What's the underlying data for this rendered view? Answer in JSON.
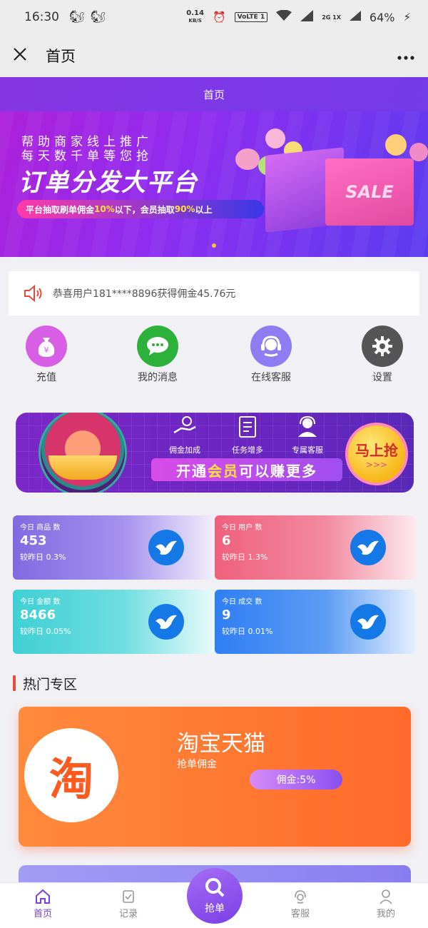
{
  "status_bar": {
    "time": "16:30",
    "speed": "0.14",
    "speed_unit": "KB/S",
    "volte": "VoLTE 1",
    "network": "2G 1X",
    "battery": "64%"
  },
  "titlebar": {
    "title": "首页"
  },
  "banner": {
    "header": "首页",
    "line1": "帮助商家线上推广",
    "line2": "每天数千单等您抢",
    "headline": "订单分发大平台",
    "pill_a": "平台抽取刷单佣金",
    "pill_b": "10%",
    "pill_c": "以下，会员抽取",
    "pill_d": "90%",
    "pill_e": "以上",
    "bag_text": "SALE"
  },
  "notice": {
    "text": "恭喜用户181****8896获得佣金45.76元"
  },
  "menu": {
    "items": [
      {
        "label": "充值",
        "icon": "money-bag-icon",
        "color": "#d95ee6"
      },
      {
        "label": "我的消息",
        "icon": "chat-icon",
        "color": "#2cb23a"
      },
      {
        "label": "在线客服",
        "icon": "headset-icon",
        "color": "#8e7df2"
      },
      {
        "label": "设置",
        "icon": "gear-icon",
        "color": "#555555"
      }
    ]
  },
  "vip": {
    "feature1": "佣金加成",
    "feature2": "任务增多",
    "feature3": "专属客服",
    "slogan_a": "开通",
    "slogan_b": "会员",
    "slogan_c": "可以赚更多",
    "grab": "马上抢",
    "arrows": ">>>"
  },
  "stats": [
    {
      "label": "今日 商品 数",
      "value": "453",
      "compare": "较昨日 0.3%"
    },
    {
      "label": "今日 用户 数",
      "value": "6",
      "compare": "较昨日 1.3%"
    },
    {
      "label": "今日 金额 数",
      "value": "8466",
      "compare": "较昨日 0.05%"
    },
    {
      "label": "今日 成交 数",
      "value": "9",
      "compare": "较昨日 0.01%"
    }
  ],
  "hot": {
    "title": "热门专区",
    "card": {
      "logo": "淘",
      "name": "淘宝天猫",
      "sub": "抢单佣金",
      "rate": "佣金:5%"
    }
  },
  "tabs": [
    {
      "label": "首页",
      "icon": "home-icon"
    },
    {
      "label": "记录",
      "icon": "record-icon"
    },
    {
      "label": "抢单",
      "icon": "search-icon"
    },
    {
      "label": "客服",
      "icon": "service-icon"
    },
    {
      "label": "我的",
      "icon": "user-icon"
    }
  ]
}
